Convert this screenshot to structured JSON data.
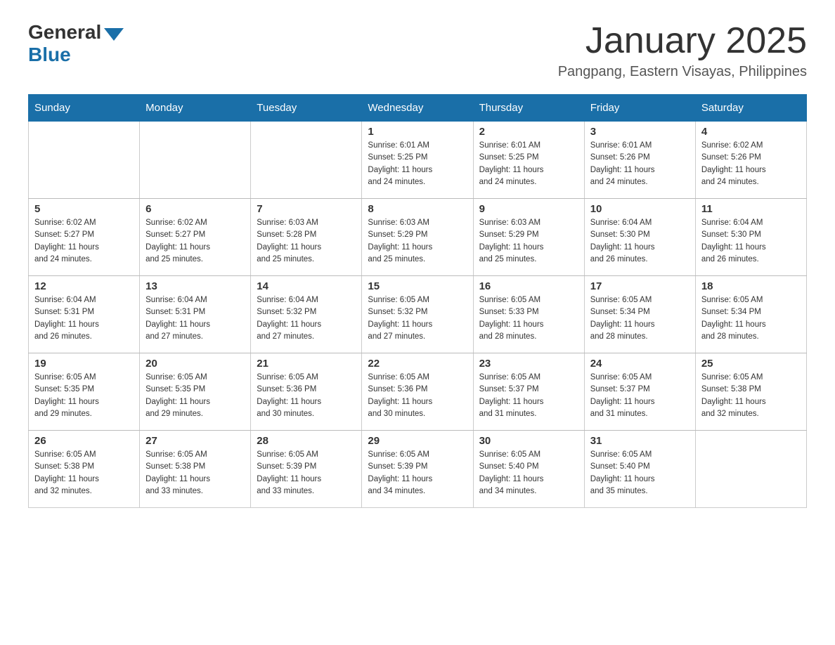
{
  "header": {
    "logo_general": "General",
    "logo_blue": "Blue",
    "month_title": "January 2025",
    "location": "Pangpang, Eastern Visayas, Philippines"
  },
  "days_of_week": [
    "Sunday",
    "Monday",
    "Tuesday",
    "Wednesday",
    "Thursday",
    "Friday",
    "Saturday"
  ],
  "weeks": [
    [
      {
        "day": "",
        "info": ""
      },
      {
        "day": "",
        "info": ""
      },
      {
        "day": "",
        "info": ""
      },
      {
        "day": "1",
        "info": "Sunrise: 6:01 AM\nSunset: 5:25 PM\nDaylight: 11 hours\nand 24 minutes."
      },
      {
        "day": "2",
        "info": "Sunrise: 6:01 AM\nSunset: 5:25 PM\nDaylight: 11 hours\nand 24 minutes."
      },
      {
        "day": "3",
        "info": "Sunrise: 6:01 AM\nSunset: 5:26 PM\nDaylight: 11 hours\nand 24 minutes."
      },
      {
        "day": "4",
        "info": "Sunrise: 6:02 AM\nSunset: 5:26 PM\nDaylight: 11 hours\nand 24 minutes."
      }
    ],
    [
      {
        "day": "5",
        "info": "Sunrise: 6:02 AM\nSunset: 5:27 PM\nDaylight: 11 hours\nand 24 minutes."
      },
      {
        "day": "6",
        "info": "Sunrise: 6:02 AM\nSunset: 5:27 PM\nDaylight: 11 hours\nand 25 minutes."
      },
      {
        "day": "7",
        "info": "Sunrise: 6:03 AM\nSunset: 5:28 PM\nDaylight: 11 hours\nand 25 minutes."
      },
      {
        "day": "8",
        "info": "Sunrise: 6:03 AM\nSunset: 5:29 PM\nDaylight: 11 hours\nand 25 minutes."
      },
      {
        "day": "9",
        "info": "Sunrise: 6:03 AM\nSunset: 5:29 PM\nDaylight: 11 hours\nand 25 minutes."
      },
      {
        "day": "10",
        "info": "Sunrise: 6:04 AM\nSunset: 5:30 PM\nDaylight: 11 hours\nand 26 minutes."
      },
      {
        "day": "11",
        "info": "Sunrise: 6:04 AM\nSunset: 5:30 PM\nDaylight: 11 hours\nand 26 minutes."
      }
    ],
    [
      {
        "day": "12",
        "info": "Sunrise: 6:04 AM\nSunset: 5:31 PM\nDaylight: 11 hours\nand 26 minutes."
      },
      {
        "day": "13",
        "info": "Sunrise: 6:04 AM\nSunset: 5:31 PM\nDaylight: 11 hours\nand 27 minutes."
      },
      {
        "day": "14",
        "info": "Sunrise: 6:04 AM\nSunset: 5:32 PM\nDaylight: 11 hours\nand 27 minutes."
      },
      {
        "day": "15",
        "info": "Sunrise: 6:05 AM\nSunset: 5:32 PM\nDaylight: 11 hours\nand 27 minutes."
      },
      {
        "day": "16",
        "info": "Sunrise: 6:05 AM\nSunset: 5:33 PM\nDaylight: 11 hours\nand 28 minutes."
      },
      {
        "day": "17",
        "info": "Sunrise: 6:05 AM\nSunset: 5:34 PM\nDaylight: 11 hours\nand 28 minutes."
      },
      {
        "day": "18",
        "info": "Sunrise: 6:05 AM\nSunset: 5:34 PM\nDaylight: 11 hours\nand 28 minutes."
      }
    ],
    [
      {
        "day": "19",
        "info": "Sunrise: 6:05 AM\nSunset: 5:35 PM\nDaylight: 11 hours\nand 29 minutes."
      },
      {
        "day": "20",
        "info": "Sunrise: 6:05 AM\nSunset: 5:35 PM\nDaylight: 11 hours\nand 29 minutes."
      },
      {
        "day": "21",
        "info": "Sunrise: 6:05 AM\nSunset: 5:36 PM\nDaylight: 11 hours\nand 30 minutes."
      },
      {
        "day": "22",
        "info": "Sunrise: 6:05 AM\nSunset: 5:36 PM\nDaylight: 11 hours\nand 30 minutes."
      },
      {
        "day": "23",
        "info": "Sunrise: 6:05 AM\nSunset: 5:37 PM\nDaylight: 11 hours\nand 31 minutes."
      },
      {
        "day": "24",
        "info": "Sunrise: 6:05 AM\nSunset: 5:37 PM\nDaylight: 11 hours\nand 31 minutes."
      },
      {
        "day": "25",
        "info": "Sunrise: 6:05 AM\nSunset: 5:38 PM\nDaylight: 11 hours\nand 32 minutes."
      }
    ],
    [
      {
        "day": "26",
        "info": "Sunrise: 6:05 AM\nSunset: 5:38 PM\nDaylight: 11 hours\nand 32 minutes."
      },
      {
        "day": "27",
        "info": "Sunrise: 6:05 AM\nSunset: 5:38 PM\nDaylight: 11 hours\nand 33 minutes."
      },
      {
        "day": "28",
        "info": "Sunrise: 6:05 AM\nSunset: 5:39 PM\nDaylight: 11 hours\nand 33 minutes."
      },
      {
        "day": "29",
        "info": "Sunrise: 6:05 AM\nSunset: 5:39 PM\nDaylight: 11 hours\nand 34 minutes."
      },
      {
        "day": "30",
        "info": "Sunrise: 6:05 AM\nSunset: 5:40 PM\nDaylight: 11 hours\nand 34 minutes."
      },
      {
        "day": "31",
        "info": "Sunrise: 6:05 AM\nSunset: 5:40 PM\nDaylight: 11 hours\nand 35 minutes."
      },
      {
        "day": "",
        "info": ""
      }
    ]
  ]
}
